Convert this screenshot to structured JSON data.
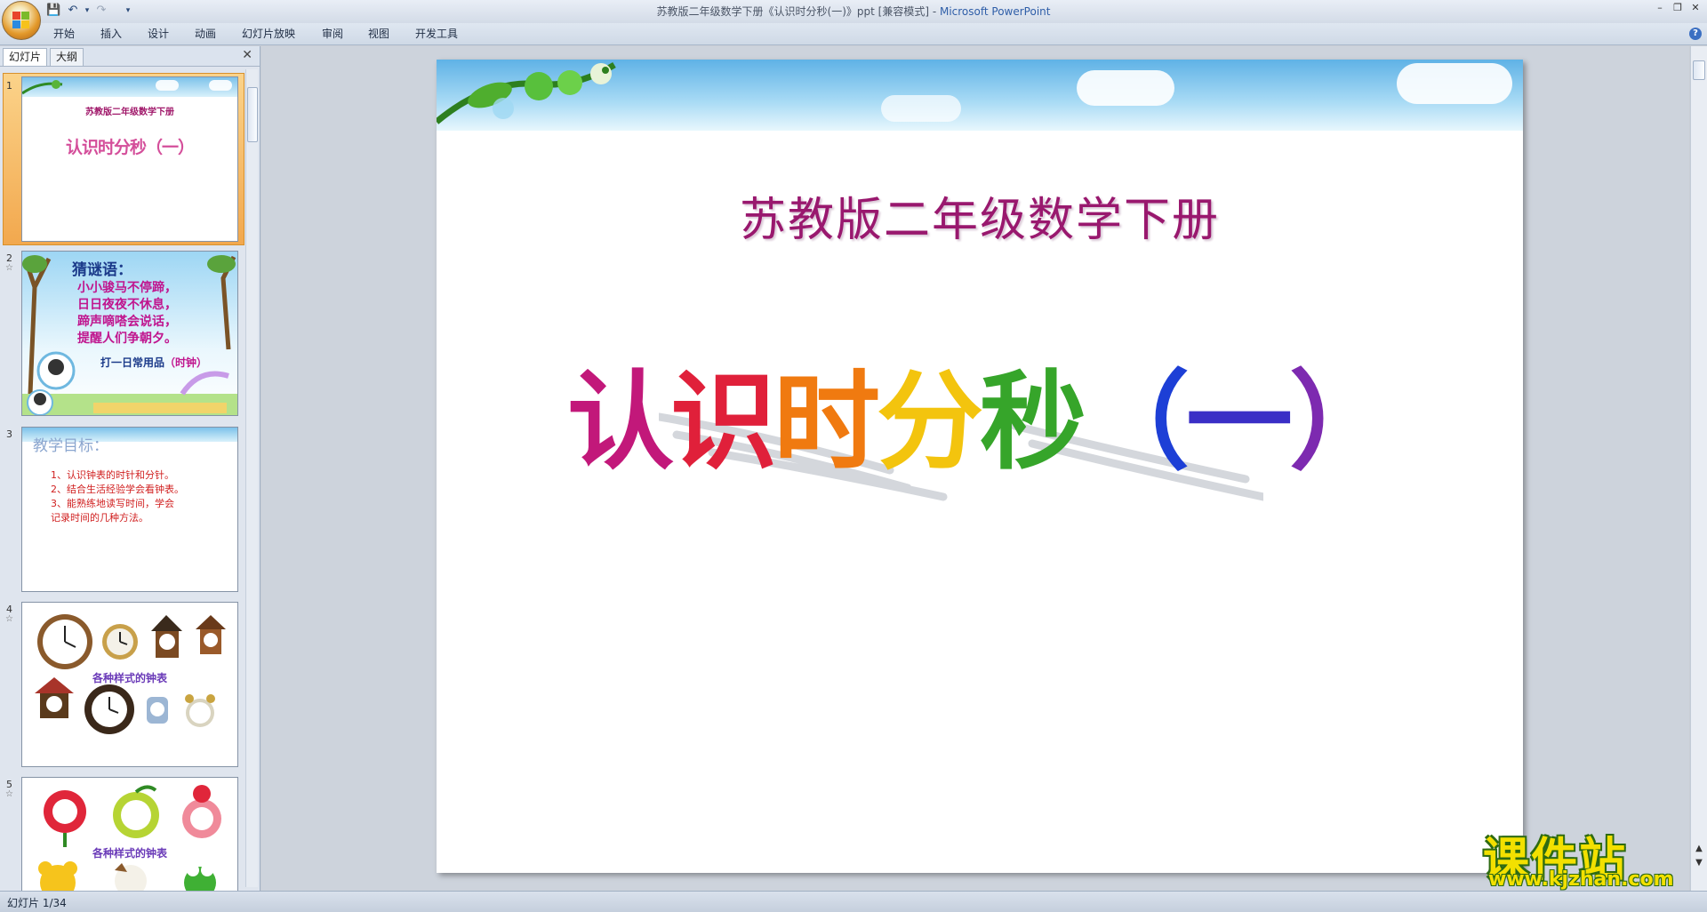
{
  "window": {
    "title": "苏教版二年级数学下册《认识时分秒(一)》ppt [兼容模式] - ",
    "app_name": "Microsoft PowerPoint"
  },
  "ribbon": {
    "tabs": [
      "开始",
      "插入",
      "设计",
      "动画",
      "幻灯片放映",
      "审阅",
      "视图",
      "开发工具"
    ]
  },
  "left_pane": {
    "tabs": [
      "幻灯片",
      "大纲"
    ]
  },
  "thumbnails": [
    {
      "num": "1",
      "line1": "苏教版二年级数学下册",
      "line2": "认识时分秒（一）"
    },
    {
      "num": "2",
      "heading": "猜谜语：",
      "lines": [
        "小小骏马不停蹄，",
        "日日夜夜不休息，",
        "蹄声嘀嗒会说话，",
        "提醒人们争朝夕。"
      ],
      "answer_prefix": "打一日常用品",
      "answer": "（时钟）"
    },
    {
      "num": "3",
      "heading": "教学目标：",
      "lines": [
        "1、认识钟表的时针和分针。",
        "2、结合生活经验学会看钟表。",
        "3、能熟练地读写时间，学会",
        "记录时间的几种方法。"
      ]
    },
    {
      "num": "4",
      "caption": "各种样式的钟表"
    },
    {
      "num": "5",
      "caption": "各种样式的钟表"
    }
  ],
  "slide": {
    "subtitle": "苏教版二年级数学下册",
    "title_chars": [
      {
        "ch": "认",
        "color": "#c2187a"
      },
      {
        "ch": "识",
        "color": "#e0203a"
      },
      {
        "ch": "时",
        "color": "#f07a10"
      },
      {
        "ch": "分",
        "color": "#f3c40e"
      },
      {
        "ch": "秒",
        "color": "#36a52a"
      },
      {
        "ch": "（",
        "color": "#1d3fd6"
      },
      {
        "ch": "一",
        "color": "#3a2fc6"
      },
      {
        "ch": "）",
        "color": "#7d2ab0"
      }
    ]
  },
  "status": {
    "text": "幻灯片 1/34"
  },
  "watermark": {
    "main": "课件站",
    "url": "www.kjzhan.com"
  }
}
